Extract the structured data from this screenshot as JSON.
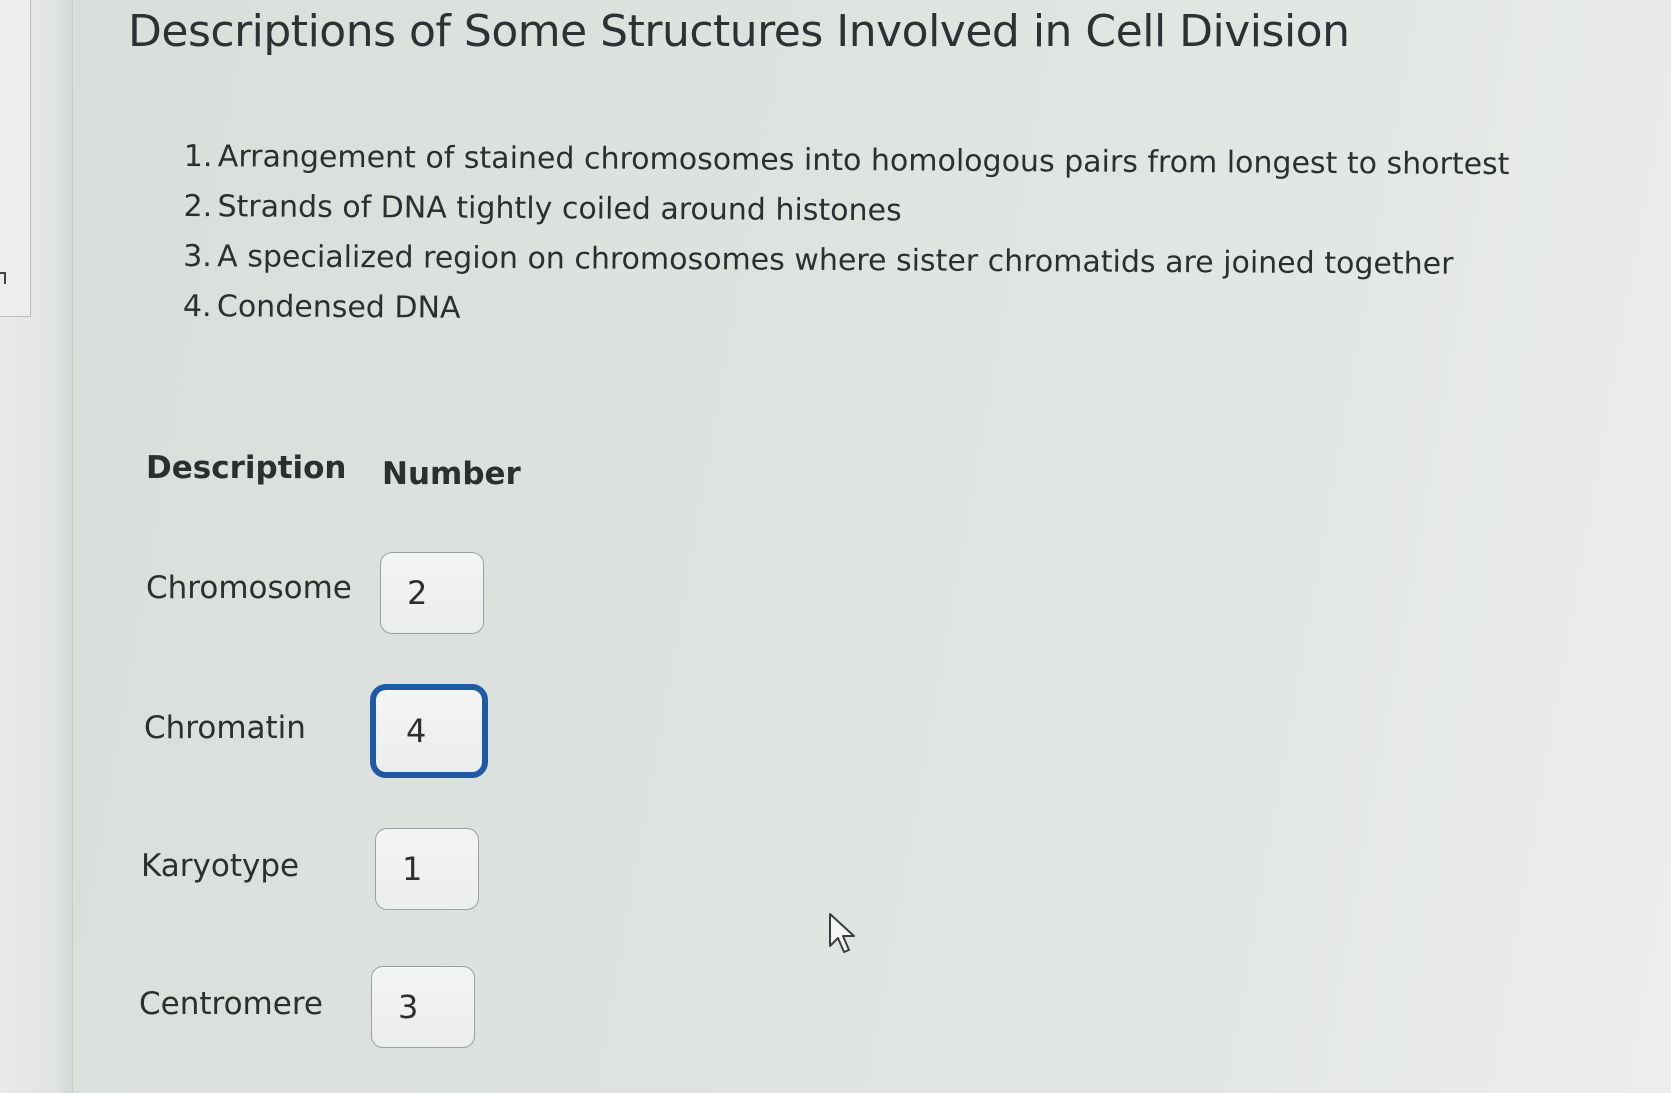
{
  "page": {
    "title": "Descriptions of Some Structures Involved in Cell Division"
  },
  "descriptions": [
    {
      "number": "1.",
      "text": "Arrangement of stained chromosomes into homologous pairs from longest to shortest"
    },
    {
      "number": "2.",
      "text": "Strands of DNA tightly coiled around histones"
    },
    {
      "number": "3.",
      "text": "A specialized region on chromosomes where sister chromatids are joined together"
    },
    {
      "number": "4.",
      "text": "Condensed DNA"
    }
  ],
  "table": {
    "header_description": "Description",
    "header_number": "Number",
    "rows": [
      {
        "label": "Chromosome",
        "value": "2"
      },
      {
        "label": "Chromatin",
        "value": "4"
      },
      {
        "label": "Karyotype",
        "value": "1"
      },
      {
        "label": "Centromere",
        "value": "3"
      }
    ]
  },
  "colors": {
    "focus_border": "#1f5aa6",
    "background": "#dde2df"
  },
  "icons": {
    "cursor": "mouse-pointer-icon"
  }
}
